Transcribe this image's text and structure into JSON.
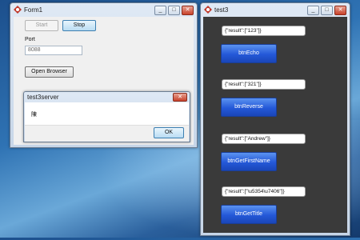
{
  "form1": {
    "title": "Form1",
    "start_label": "Start",
    "stop_label": "Stop",
    "port_label": "Port",
    "port_value": "8088",
    "open_browser_label": "Open Browser"
  },
  "dialog": {
    "title": "test3server",
    "message": "陳",
    "ok_label": "OK",
    "close_glyph": "✕"
  },
  "test3": {
    "title": "test3",
    "items": [
      {
        "result": "{\"result\":[\"123\"]}",
        "button": "btnEcho"
      },
      {
        "result": "{\"result\":[\"321\"]}",
        "button": "btnReverse"
      },
      {
        "result": "{\"result\":[\"Andrew\"]}",
        "button": "btnGetFirstName"
      },
      {
        "result": "{\"result\":[\"\\u5354\\u7406\"]}",
        "button": "btnGetTitle"
      }
    ]
  },
  "window_controls": {
    "minimize": "_",
    "maximize": "□",
    "close": "✕"
  }
}
